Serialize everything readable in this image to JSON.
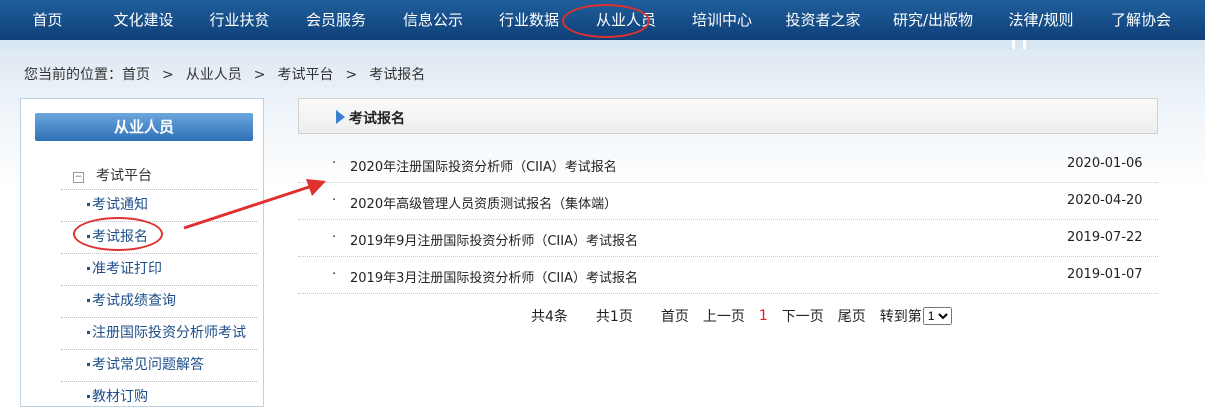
{
  "nav": {
    "items": [
      "首页",
      "文化建设",
      "行业扶贫",
      "会员服务",
      "信息公示",
      "行业数据",
      "从业人员",
      "培训中心",
      "投资者之家",
      "研究/出版物",
      "法律/规则",
      "了解协会"
    ],
    "active_index": 6
  },
  "breadcrumb": {
    "prefix": "您当前的位置：",
    "items": [
      "首页",
      "从业人员",
      "考试平台",
      "考试报名"
    ],
    "sep": ">"
  },
  "sidebar": {
    "title": "从业人员",
    "root": "考试平台",
    "items": [
      {
        "label": "考试通知"
      },
      {
        "label": "考试报名"
      },
      {
        "label": "准考证打印"
      },
      {
        "label": "考试成绩查询"
      },
      {
        "label": "注册国际投资分析师考试"
      },
      {
        "label": "考试常见问题解答"
      },
      {
        "label": "教材订购"
      }
    ]
  },
  "main": {
    "title": "考试报名",
    "bullet": "·",
    "rows": [
      {
        "title": "2020年注册国际投资分析师（CIIA）考试报名",
        "date": "2020-01-06"
      },
      {
        "title": "2020年高级管理人员资质测试报名（集体端）",
        "date": "2020-04-20"
      },
      {
        "title": "2019年9月注册国际投资分析师（CIIA）考试报名",
        "date": "2019-07-22"
      },
      {
        "title": "2019年3月注册国际投资分析师（CIIA）考试报名",
        "date": "2019-01-07"
      }
    ]
  },
  "pager": {
    "total": "共4条",
    "pages": "共1页",
    "first": "首页",
    "prev": "上一页",
    "current": "1",
    "next": "下一页",
    "last": "尾页",
    "goto": "转到第",
    "select_value": "1"
  },
  "colors": {
    "annotation": "#e03030",
    "nav": "#1f5f9c",
    "link": "#1e4f8a"
  }
}
